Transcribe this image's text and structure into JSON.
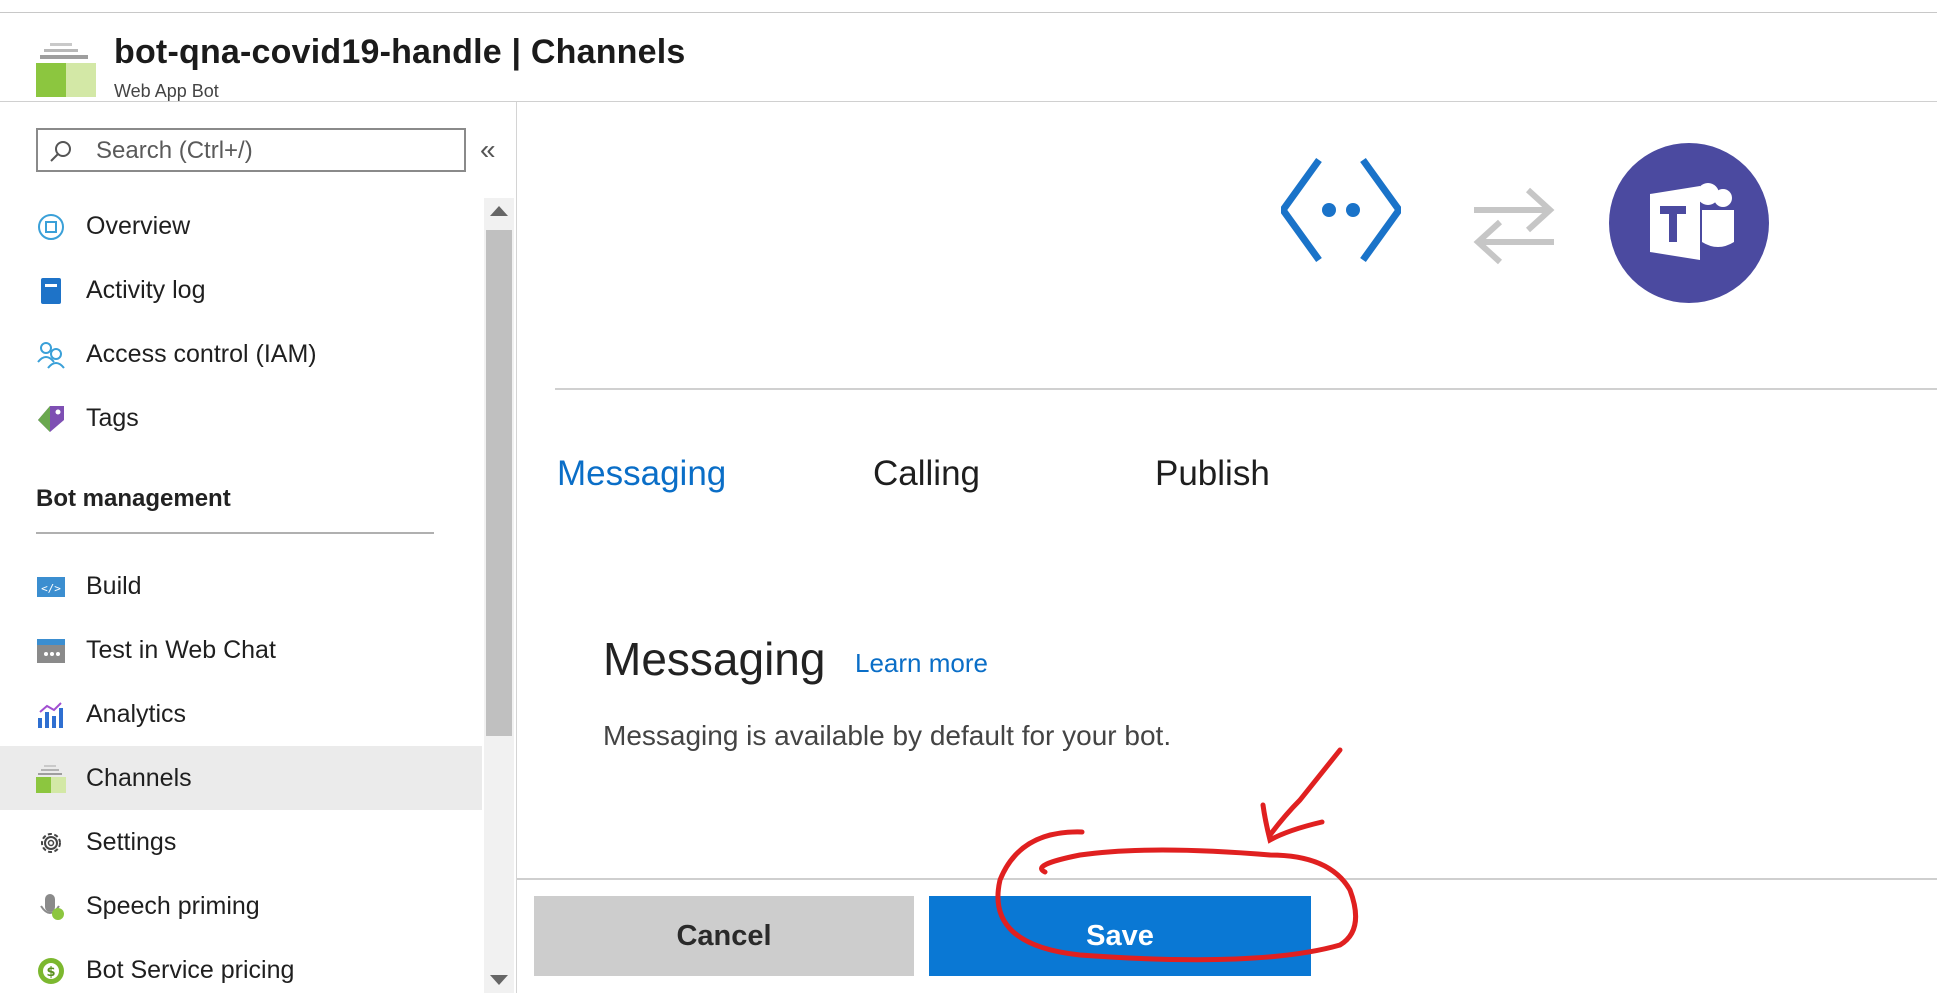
{
  "header": {
    "title": "bot-qna-covid19-handle | Channels",
    "subtitle": "Web App Bot",
    "resource_icon": "channels-stack-icon"
  },
  "sidebar": {
    "search_placeholder": "Search (Ctrl+/)",
    "collapse_glyph": "«",
    "items_top": [
      {
        "label": "Overview",
        "icon": "overview-icon"
      },
      {
        "label": "Activity log",
        "icon": "activity-log-icon"
      },
      {
        "label": "Access control (IAM)",
        "icon": "access-control-icon"
      },
      {
        "label": "Tags",
        "icon": "tags-icon"
      }
    ],
    "section_title": "Bot management",
    "items_bot": [
      {
        "label": "Build",
        "icon": "build-icon"
      },
      {
        "label": "Test in Web Chat",
        "icon": "web-chat-icon"
      },
      {
        "label": "Analytics",
        "icon": "analytics-icon"
      },
      {
        "label": "Channels",
        "icon": "channels-icon",
        "active": true
      },
      {
        "label": "Settings",
        "icon": "gear-icon"
      },
      {
        "label": "Speech priming",
        "icon": "speech-priming-icon"
      },
      {
        "label": "Bot Service pricing",
        "icon": "pricing-icon"
      }
    ]
  },
  "main": {
    "hero_icons": [
      "bot-icon",
      "swap-arrows-icon",
      "teams-icon"
    ],
    "tabs": [
      {
        "label": "Messaging",
        "active": true
      },
      {
        "label": "Calling",
        "active": false
      },
      {
        "label": "Publish",
        "active": false
      }
    ],
    "section_title": "Messaging",
    "learn_more": "Learn more",
    "description": "Messaging is available by default for your bot.",
    "buttons": {
      "cancel": "Cancel",
      "save": "Save"
    }
  },
  "colors": {
    "accent": "#0a78d4",
    "link": "#0a6ec7",
    "teams": "#4b4aa0",
    "annotation": "#e02020"
  }
}
